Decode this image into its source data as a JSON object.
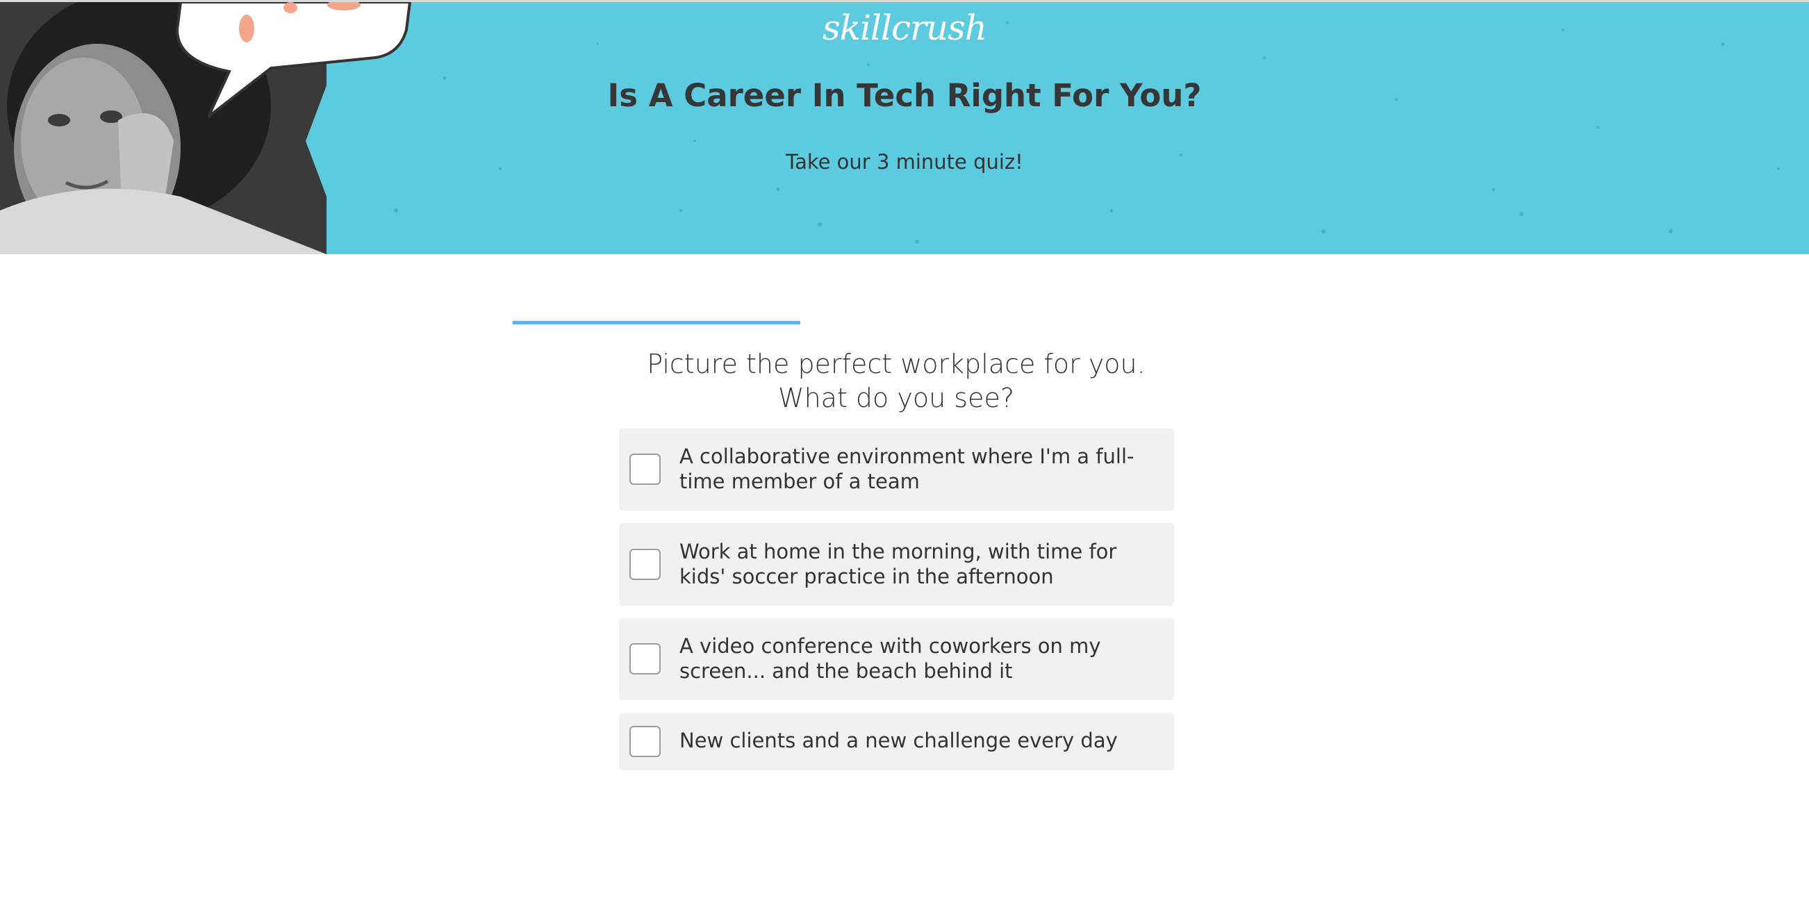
{
  "brand": {
    "logo_text": "skillcrush"
  },
  "hero": {
    "title": "Is A Career In Tech Right For You?",
    "subtitle": "Take our 3 minute quiz!",
    "background_color": "#5ccbdf"
  },
  "progress": {
    "fraction": 0.6,
    "color": "#5fb3e6"
  },
  "question": {
    "line1": "Picture the perfect workplace for you.",
    "line2": "What do you see?"
  },
  "options": [
    {
      "label": "A collaborative environment where I'm a full-time member of a team",
      "checked": false
    },
    {
      "label": "Work at home in the morning, with time for kids' soccer practice in the afternoon",
      "checked": false
    },
    {
      "label": "A video conference with coworkers on my screen... and the beach behind it",
      "checked": false
    },
    {
      "label": "New clients and a new challenge every day",
      "checked": false
    }
  ]
}
